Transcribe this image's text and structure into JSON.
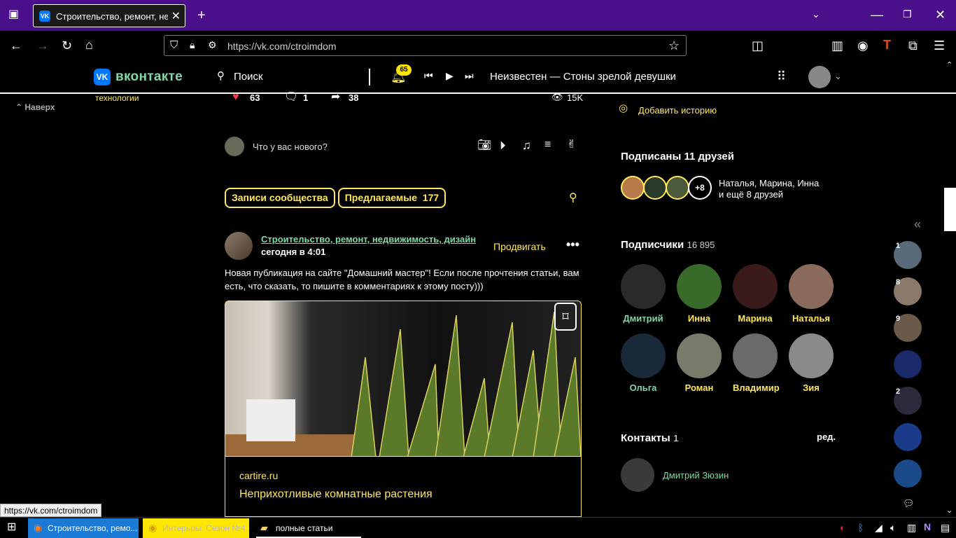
{
  "browser": {
    "tab_title": "Строительство, ремонт, недви",
    "url": "https://vk.com/ctroimdom",
    "status_url": "https://vk.com/ctroimdom"
  },
  "vk": {
    "logo_text": "вконтакте",
    "search_label": "Поиск",
    "notifications": "65",
    "track": "Неизвестен — Стоны зрелой девушки"
  },
  "left": {
    "scroll_top": "Наверх",
    "tech_label": "технологии"
  },
  "prev_post": {
    "likes": "63",
    "comments": "1",
    "shares": "38",
    "views": "15K"
  },
  "composer": {
    "placeholder": "Что у вас нового?"
  },
  "tabs": {
    "community": "Записи сообщества",
    "suggested": "Предлагаемые",
    "suggested_count": "177"
  },
  "post": {
    "author": "Строительство, ремонт, недвижимость, дизайн",
    "time": "сегодня в 4:01",
    "promote": "Продвигать",
    "text": "Новая публикация на сайте \"Домашний мастер\"! Если после прочтения статьи, вам есть, что сказать, то пишите в комментариях к этому посту)))",
    "link_domain": "cartire.ru",
    "link_title": "Неприхотливые комнатные растения"
  },
  "sidebar": {
    "add_story": "Добавить историю",
    "friends_title": "Подписаны 11 друзей",
    "friends_more": "+8",
    "friends_line1": "Наталья, Марина, Инна",
    "friends_line2": "и ещё 8 друзей",
    "subscribers_title": "Подписчики",
    "subscribers_count": "16 895",
    "subscribers": [
      {
        "name": "Дмитрий"
      },
      {
        "name": "Инна"
      },
      {
        "name": "Марина"
      },
      {
        "name": "Наталья"
      },
      {
        "name": "Ольга"
      },
      {
        "name": "Роман"
      },
      {
        "name": "Владимир"
      },
      {
        "name": "Зия"
      }
    ],
    "contacts_title": "Контакты",
    "contacts_count": "1",
    "contacts_edit": "ред.",
    "contact_name": "Дмитрий Зюзин"
  },
  "rail": {
    "badges": [
      "1",
      "8",
      "9",
      "2"
    ],
    "collapse": "«"
  },
  "taskbar": {
    "items": [
      "Строительство, ремо...",
      "Интерьры. Сезон №4...",
      "полные статьи"
    ]
  },
  "colors": {
    "accent_yellow": "#ffe85c",
    "accent_green": "#7fd8a8",
    "tab_bar": "#4a0f8a",
    "vk_blue": "#0077ff"
  }
}
